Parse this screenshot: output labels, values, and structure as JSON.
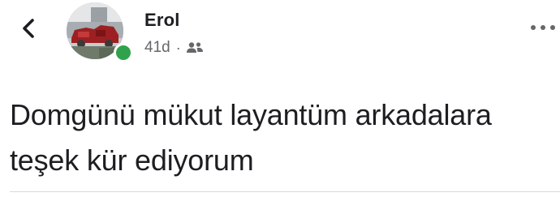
{
  "post": {
    "author_name": "Erol",
    "timestamp": "41d",
    "separator": "·",
    "audience_icon": "friends-icon",
    "more_icon": "more-options-icon",
    "back_icon": "back-chevron-icon",
    "avatar_icon": "profile-picture",
    "online_status": "online",
    "text": "Domgünü mükut layantüm arkadalara teşek kür ediyorum"
  },
  "colors": {
    "online_dot": "#31a24c",
    "meta_text": "#65676b",
    "body_text": "#1c1e21",
    "divider": "#d8dadf"
  }
}
